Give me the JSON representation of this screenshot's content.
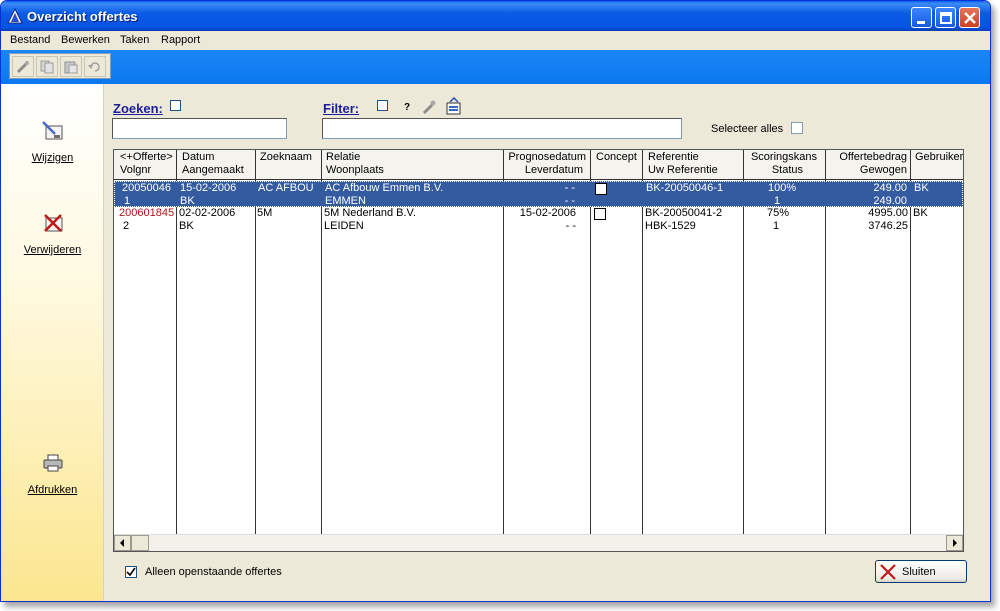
{
  "window": {
    "title": "Overzicht offertes"
  },
  "menu": [
    "Bestand",
    "Bewerken",
    "Taken",
    "Rapport"
  ],
  "toolbar": {
    "buttons": [
      {
        "icon": "wand-icon"
      },
      {
        "icon": "copy-icon"
      },
      {
        "icon": "paste-icon"
      },
      {
        "icon": "undo-icon"
      }
    ]
  },
  "sidebar": {
    "edit_label": "Wijzigen",
    "delete_label": "Verwijderen",
    "print_label": "Afdrukken"
  },
  "search": {
    "label": "Zoeken:",
    "value": ""
  },
  "filter": {
    "label": "Filter:",
    "help": "?",
    "value": ""
  },
  "select_all_label": "Selecteer alles",
  "table": {
    "headers": [
      [
        "<+Offerte>",
        "Volgnr"
      ],
      [
        "Datum",
        "Aangemaakt"
      ],
      [
        "Zoeknaam",
        ""
      ],
      [
        "Relatie",
        "Woonplaats"
      ],
      [
        "Prognosedatum",
        "Leverdatum"
      ],
      [
        "Concept",
        ""
      ],
      [
        "Referentie",
        "Uw Referentie"
      ],
      [
        "Scoringskans",
        "Status"
      ],
      [
        "Offertebedrag",
        "Gewogen"
      ],
      [
        "Gebruiker",
        ""
      ]
    ],
    "rows": [
      {
        "offerte": "20050046",
        "volgnr": "1",
        "datum": "15-02-2006",
        "aangemaakt": "BK",
        "zoeknaam": "AC AFBOU",
        "relatie": "AC Afbouw Emmen B.V.",
        "woonplaats": "EMMEN",
        "prognosedatum": "- -",
        "leverdatum": "- -",
        "referentie": "BK-20050046-1",
        "uw_referentie": "",
        "scoringskans": "100%",
        "status": "1",
        "offertebedrag": "249.00",
        "gewogen": "249.00",
        "gebruiker": "BK",
        "selected": true
      },
      {
        "offerte": "200601845",
        "volgnr": "2",
        "datum": "02-02-2006",
        "aangemaakt": "BK",
        "zoeknaam": "5M",
        "relatie": "5M Nederland B.V.",
        "woonplaats": "LEIDEN",
        "prognosedatum": "15-02-2006",
        "leverdatum": "- -",
        "referentie": "BK-20050041-2",
        "uw_referentie": "HBK-1529",
        "scoringskans": "75%",
        "status": "1",
        "offertebedrag": "4995.00",
        "gewogen": "3746.25",
        "gebruiker": "BK",
        "selected": false
      }
    ]
  },
  "only_open_label": "Alleen openstaande offertes",
  "close_label": "Sluiten"
}
